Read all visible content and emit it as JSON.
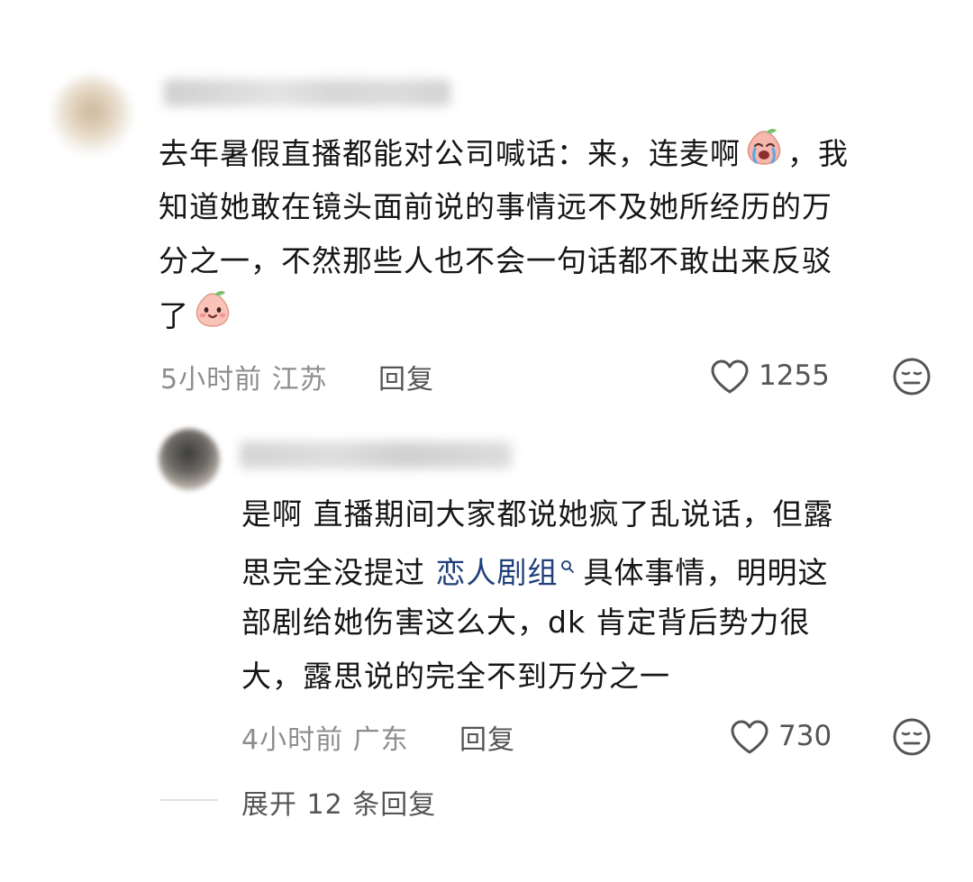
{
  "comment": {
    "lines": [
      "去年暑假直播都能对公司喊话：来，连麦啊",
      "，我",
      "知道她敢在镜头面前说的事情远不及她所经历的万",
      "分之一，不然那些人也不会一句话都不敢出来反驳",
      "了"
    ],
    "emojis": [
      "crying-peach-emoji",
      "smiling-peach-emoji"
    ],
    "time": "5小时前",
    "location": "江苏",
    "reply_label": "回复",
    "likes": "1255",
    "icons": [
      "heart-outline-icon",
      "meh-face-icon"
    ]
  },
  "reply": {
    "lines": [
      "是啊 直播期间大家都说她疯了乱说话，但露",
      "思完全没提过",
      "恋人剧组",
      "具体事情，明明这",
      "部剧给她伤害这么大，dk 肯定背后势力很",
      "大，露思说的完全不到万分之一"
    ],
    "search_icon": "search-icon",
    "time": "4小时前",
    "location": "广东",
    "reply_label": "回复",
    "likes": "730"
  },
  "expand": {
    "label": "展开 12 条回复"
  },
  "colors": {
    "text": "#161616",
    "meta": "#8d8d8d",
    "action": "#555555",
    "topic_link": "#1f3f7a"
  }
}
